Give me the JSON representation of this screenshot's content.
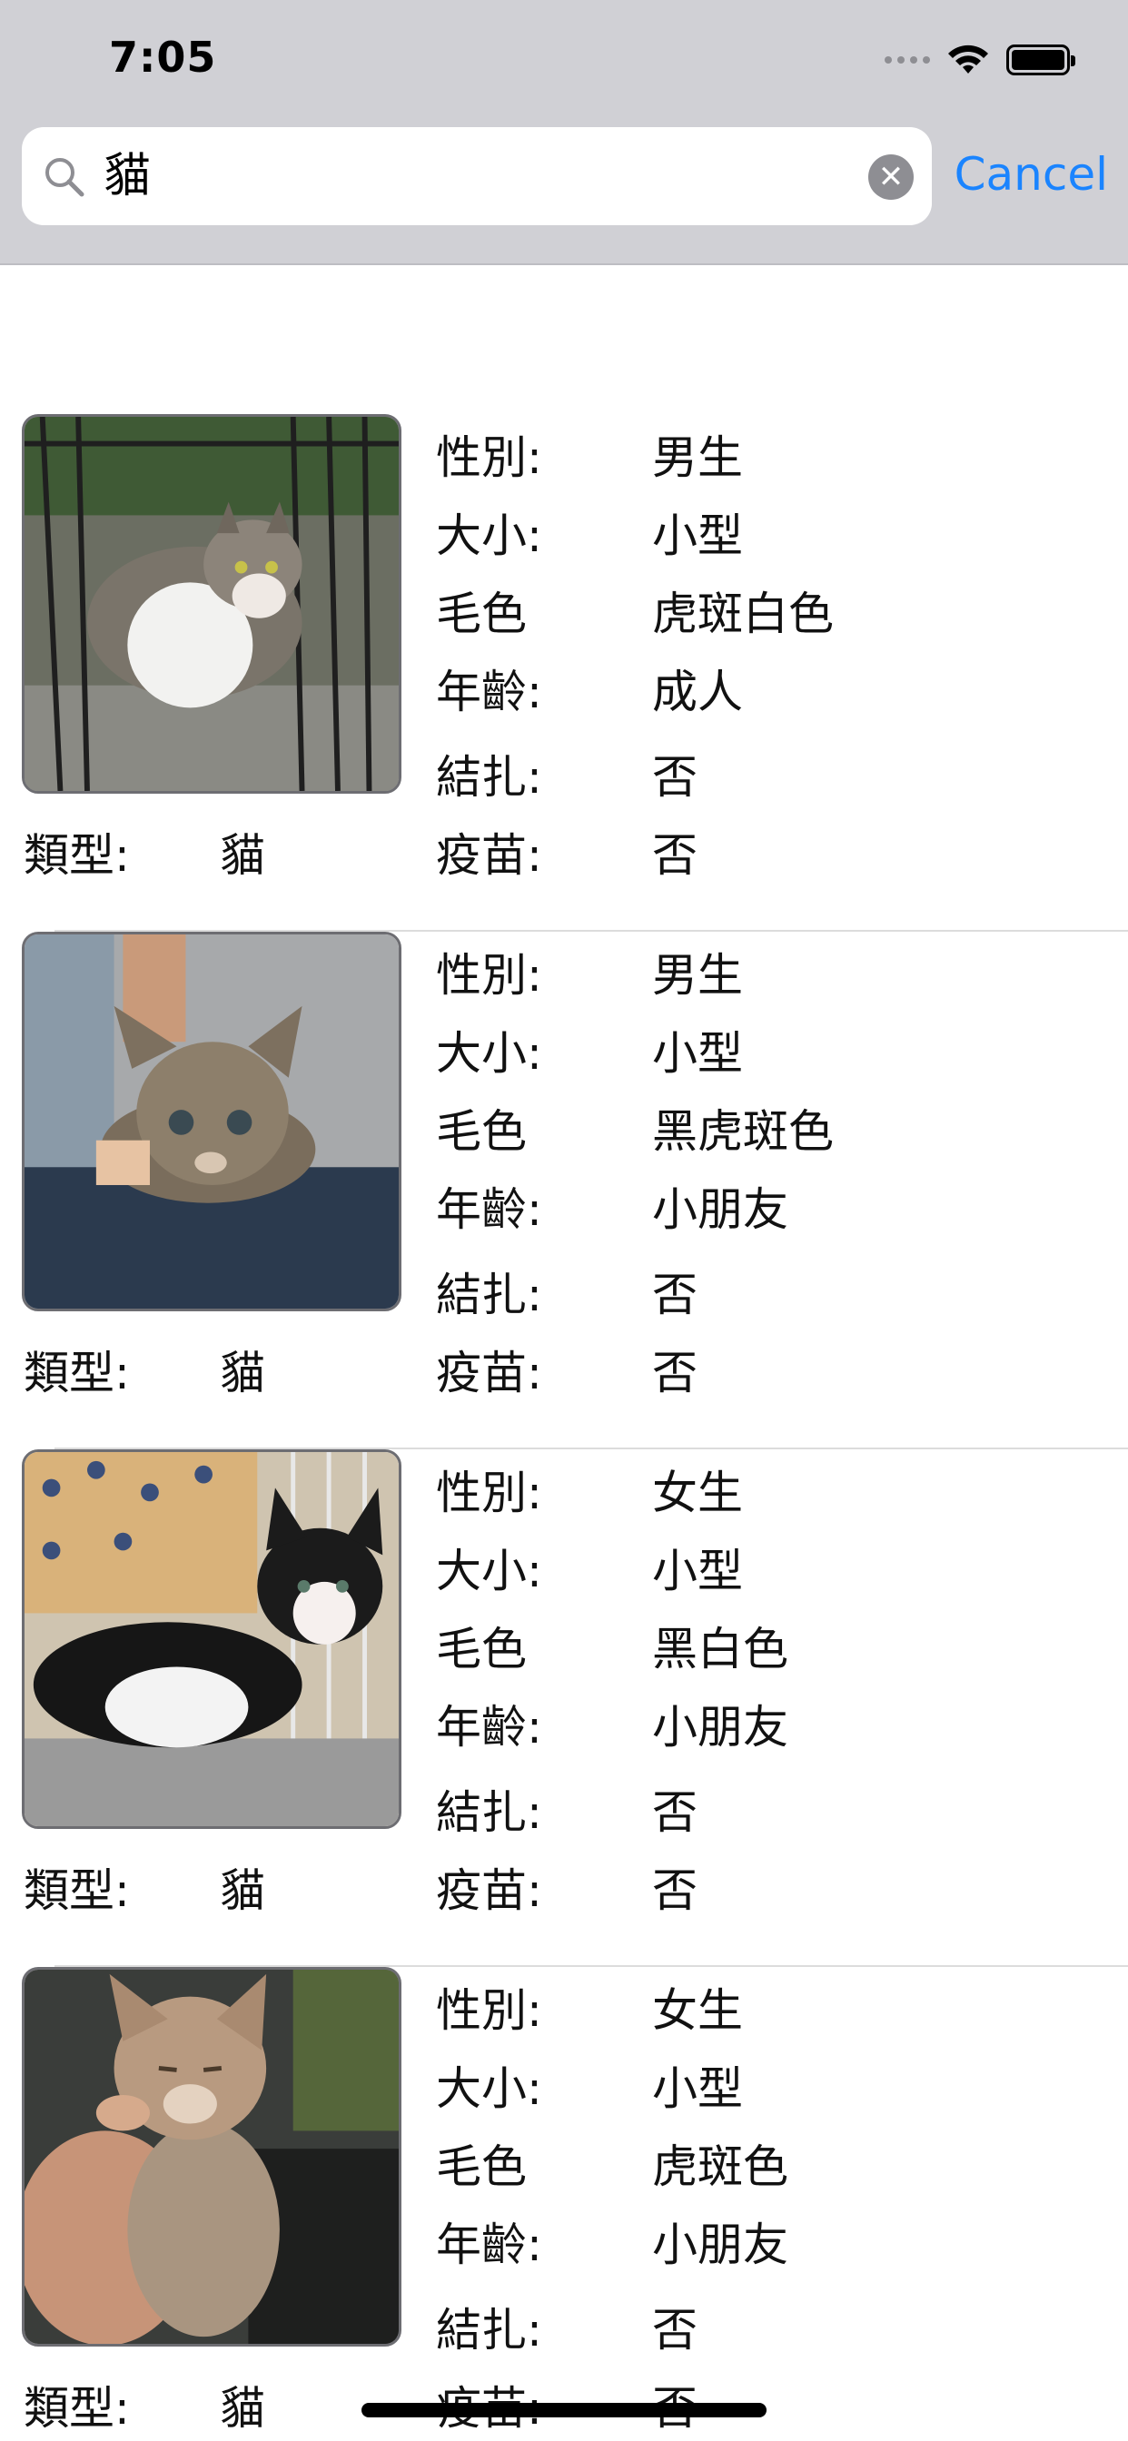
{
  "status_bar": {
    "time": "7:05",
    "icons": [
      "cellular-dots-icon",
      "wifi-icon",
      "battery-icon"
    ]
  },
  "search": {
    "query": "貓",
    "cancel_label": "Cancel",
    "icons": [
      "search-icon",
      "clear-icon"
    ],
    "accent_color": "#1a84ff"
  },
  "labels": {
    "gender": "性別:",
    "size": "大小:",
    "color": "毛色",
    "age": "年齡:",
    "neutered": "結扎:",
    "vaccine": "疫苗:",
    "type": "類型:"
  },
  "pets": [
    {
      "type": "貓",
      "gender": "男生",
      "size": "小型",
      "color": "虎斑白色",
      "age": "成人",
      "neutered": "否",
      "vaccine": "否"
    },
    {
      "type": "貓",
      "gender": "男生",
      "size": "小型",
      "color": "黑虎斑色",
      "age": "小朋友",
      "neutered": "否",
      "vaccine": "否"
    },
    {
      "type": "貓",
      "gender": "女生",
      "size": "小型",
      "color": "黑白色",
      "age": "小朋友",
      "neutered": "否",
      "vaccine": "否"
    },
    {
      "type": "貓",
      "gender": "女生",
      "size": "小型",
      "color": "虎斑色",
      "age": "小朋友",
      "neutered": "否",
      "vaccine": "否"
    }
  ]
}
